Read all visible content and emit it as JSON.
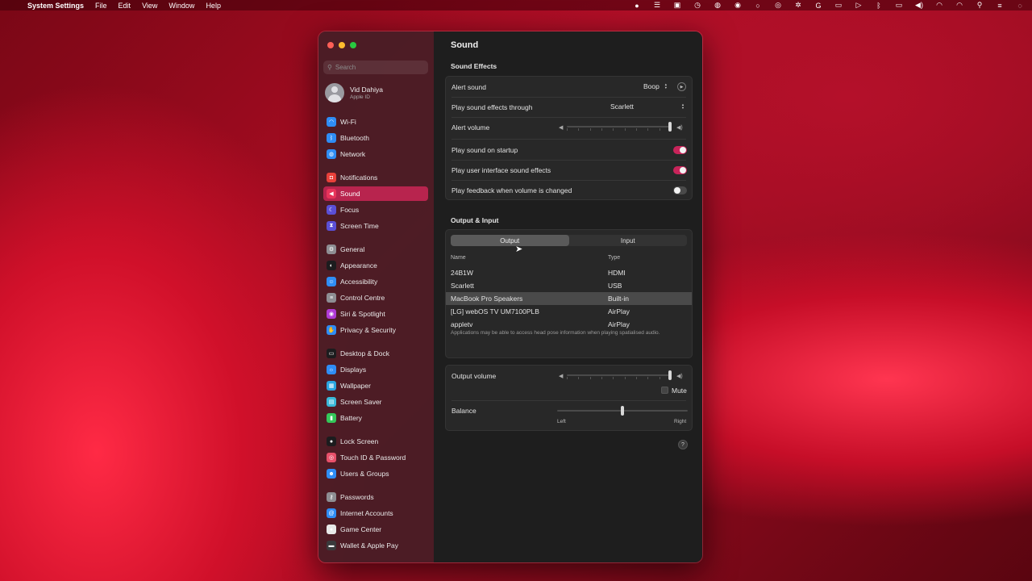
{
  "menubar": {
    "app_name": "System Settings",
    "menus": [
      "File",
      "Edit",
      "View",
      "Window",
      "Help"
    ],
    "status_icons": [
      "record-icon",
      "list-icon",
      "screenshot-icon",
      "clock-icon",
      "vpn-icon",
      "record-dot-icon",
      "circle-icon",
      "wechat-icon",
      "pinwheel-icon",
      "google-icon",
      "display-icon",
      "play-icon",
      "bluetooth-icon",
      "battery-icon",
      "volume-icon",
      "airdrop-icon",
      "wifi-icon",
      "search-icon",
      "control-center-icon",
      "siri-icon"
    ]
  },
  "sidebar": {
    "search_placeholder": "Search",
    "user": {
      "name": "Vid Dahiya",
      "subtitle": "Apple ID"
    },
    "items": [
      {
        "label": "Wi-Fi",
        "icon": "wifi-icon",
        "color": "#2f8df5"
      },
      {
        "label": "Bluetooth",
        "icon": "bluetooth-icon",
        "color": "#2f8df5"
      },
      {
        "label": "Network",
        "icon": "globe-icon",
        "color": "#2f8df5"
      },
      {
        "label": "Notifications",
        "icon": "bell-icon",
        "color": "#e8403a"
      },
      {
        "label": "Sound",
        "icon": "speaker-icon",
        "color": "#e8335a",
        "active": true
      },
      {
        "label": "Focus",
        "icon": "moon-icon",
        "color": "#5b4fd6"
      },
      {
        "label": "Screen Time",
        "icon": "hourglass-icon",
        "color": "#5b4fd6"
      },
      {
        "label": "General",
        "icon": "gear-icon",
        "color": "#8e8e93"
      },
      {
        "label": "Appearance",
        "icon": "appearance-icon",
        "color": "#1c1c1e"
      },
      {
        "label": "Accessibility",
        "icon": "accessibility-icon",
        "color": "#2f8df5"
      },
      {
        "label": "Control Centre",
        "icon": "control-centre-icon",
        "color": "#8e8e93"
      },
      {
        "label": "Siri & Spotlight",
        "icon": "siri-icon",
        "color": "#b03ad6"
      },
      {
        "label": "Privacy & Security",
        "icon": "hand-icon",
        "color": "#2f8df5"
      },
      {
        "label": "Desktop & Dock",
        "icon": "dock-icon",
        "color": "#1c1c1e"
      },
      {
        "label": "Displays",
        "icon": "sun-icon",
        "color": "#2f8df5"
      },
      {
        "label": "Wallpaper",
        "icon": "wallpaper-icon",
        "color": "#2aa6e0"
      },
      {
        "label": "Screen Saver",
        "icon": "screensaver-icon",
        "color": "#3ab8d8"
      },
      {
        "label": "Battery",
        "icon": "battery-icon",
        "color": "#34c759"
      },
      {
        "label": "Lock Screen",
        "icon": "lock-icon",
        "color": "#1c1c1e"
      },
      {
        "label": "Touch ID & Password",
        "icon": "fingerprint-icon",
        "color": "#e8506a"
      },
      {
        "label": "Users & Groups",
        "icon": "users-icon",
        "color": "#2f8df5"
      },
      {
        "label": "Passwords",
        "icon": "key-icon",
        "color": "#8e8e93"
      },
      {
        "label": "Internet Accounts",
        "icon": "at-icon",
        "color": "#2f8df5"
      },
      {
        "label": "Game Center",
        "icon": "game-center-icon",
        "color": "#e8e8e8"
      },
      {
        "label": "Wallet & Apple Pay",
        "icon": "wallet-icon",
        "color": "#3a3a3c"
      }
    ]
  },
  "content": {
    "title": "Sound",
    "sound_effects": {
      "heading": "Sound Effects",
      "alert_sound_label": "Alert sound",
      "alert_sound_value": "Boop",
      "effects_through_label": "Play sound effects through",
      "effects_through_value": "Scarlett",
      "alert_volume_label": "Alert volume",
      "alert_volume_level": 1.0,
      "startup_label": "Play sound on startup",
      "startup_on": true,
      "ui_effects_label": "Play user interface sound effects",
      "ui_effects_on": true,
      "feedback_label": "Play feedback when volume is changed",
      "feedback_on": false
    },
    "output_input": {
      "heading": "Output & Input",
      "tabs": [
        "Output",
        "Input"
      ],
      "selected_tab": "Output",
      "columns": [
        "Name",
        "Type"
      ],
      "devices": [
        {
          "name": "24B1W",
          "type": "HDMI"
        },
        {
          "name": "Scarlett",
          "type": "USB"
        },
        {
          "name": "MacBook Pro Speakers",
          "type": "Built-in",
          "selected": true
        },
        {
          "name": "[LG] webOS TV UM7100PLB",
          "type": "AirPlay"
        },
        {
          "name": "appletv",
          "type": "AirPlay"
        }
      ],
      "note": "Applications may be able to access head pose information when playing spatialised audio."
    },
    "volume": {
      "output_volume_label": "Output volume",
      "output_volume_level": 1.0,
      "mute_label": "Mute",
      "muted": false,
      "balance_label": "Balance",
      "balance_left": "Left",
      "balance_right": "Right",
      "balance_level": 0.5
    },
    "help_label": "?"
  }
}
